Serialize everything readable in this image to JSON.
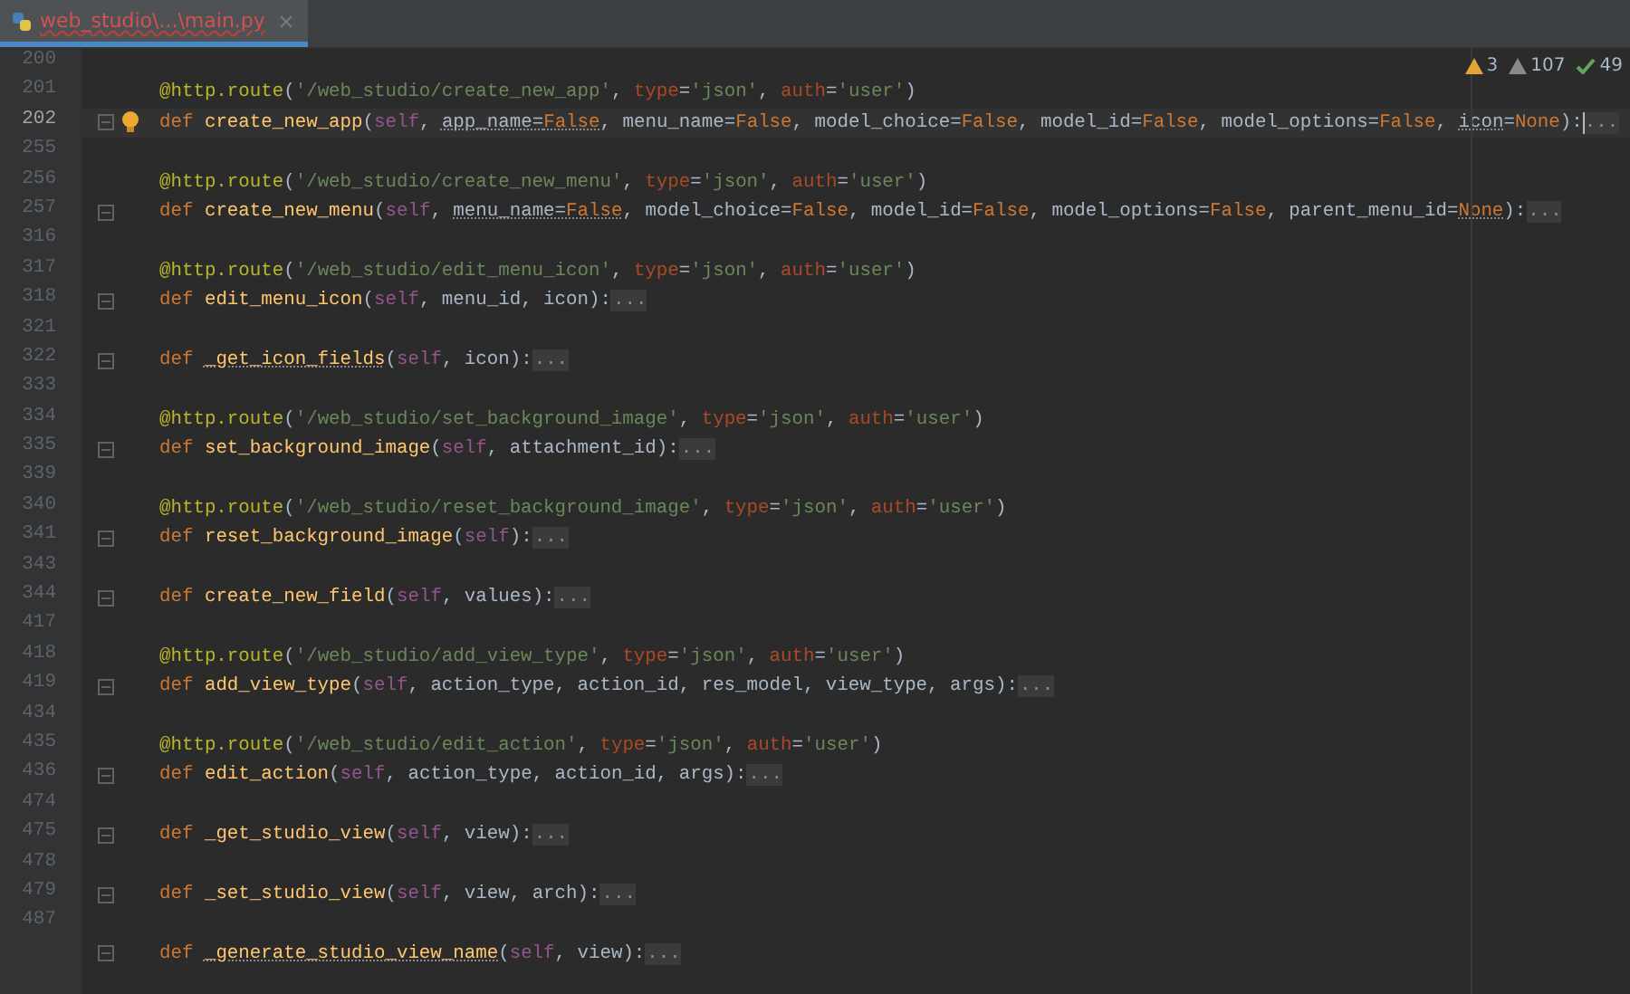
{
  "tab": {
    "title": "web_studio\\...\\main.py",
    "selected": true
  },
  "inspections": [
    {
      "kind": "warning",
      "count": "3"
    },
    {
      "kind": "weak",
      "count": "107"
    },
    {
      "kind": "typo",
      "count": "49"
    }
  ],
  "lines": [
    {
      "number": "200"
    },
    {
      "number": "201",
      "tokens": [
        {
          "kind": "deco",
          "text": "@http.route"
        },
        {
          "kind": "punct",
          "text": "("
        },
        {
          "kind": "str",
          "text": "'/web_studio/create_new_app'"
        },
        {
          "kind": "punct",
          "text": ", "
        },
        {
          "kind": "kwarg",
          "text": "type"
        },
        {
          "kind": "punct",
          "text": "="
        },
        {
          "kind": "str",
          "text": "'json'"
        },
        {
          "kind": "punct",
          "text": ", "
        },
        {
          "kind": "kwarg",
          "text": "auth"
        },
        {
          "kind": "punct",
          "text": "="
        },
        {
          "kind": "str",
          "text": "'user'"
        },
        {
          "kind": "punct",
          "text": ")"
        }
      ]
    },
    {
      "number": "202",
      "current": true,
      "intention": true,
      "foldable": true,
      "tokens": [
        {
          "kind": "kw",
          "text": "def "
        },
        {
          "kind": "fn",
          "text": "create_new_app"
        },
        {
          "kind": "punct",
          "text": "("
        },
        {
          "kind": "self",
          "text": "self"
        },
        {
          "kind": "punct",
          "text": ", "
        },
        {
          "kind": "param",
          "text": "app_name",
          "warn": true
        },
        {
          "kind": "punct",
          "text": "=",
          "warn": true
        },
        {
          "kind": "const",
          "text": "False",
          "warn": true
        },
        {
          "kind": "punct",
          "text": ", menu_name="
        },
        {
          "kind": "const",
          "text": "False"
        },
        {
          "kind": "punct",
          "text": ", model_choice="
        },
        {
          "kind": "const",
          "text": "False"
        },
        {
          "kind": "punct",
          "text": ", model_id="
        },
        {
          "kind": "const",
          "text": "False"
        },
        {
          "kind": "punct",
          "text": ", model_options="
        },
        {
          "kind": "const",
          "text": "False"
        },
        {
          "kind": "punct",
          "text": ", "
        },
        {
          "kind": "param",
          "text": "icon",
          "warn": true
        },
        {
          "kind": "punct",
          "text": "="
        },
        {
          "kind": "const",
          "text": "None"
        },
        {
          "kind": "punct",
          "text": "):"
        },
        {
          "kind": "fold",
          "text": "..."
        }
      ]
    },
    {
      "number": "255"
    },
    {
      "number": "256",
      "tokens": [
        {
          "kind": "deco",
          "text": "@http.route"
        },
        {
          "kind": "punct",
          "text": "("
        },
        {
          "kind": "str",
          "text": "'/web_studio/create_new_menu'"
        },
        {
          "kind": "punct",
          "text": ", "
        },
        {
          "kind": "kwarg",
          "text": "type"
        },
        {
          "kind": "punct",
          "text": "="
        },
        {
          "kind": "str",
          "text": "'json'"
        },
        {
          "kind": "punct",
          "text": ", "
        },
        {
          "kind": "kwarg",
          "text": "auth"
        },
        {
          "kind": "punct",
          "text": "="
        },
        {
          "kind": "str",
          "text": "'user'"
        },
        {
          "kind": "punct",
          "text": ")"
        }
      ]
    },
    {
      "number": "257",
      "foldable": true,
      "tokens": [
        {
          "kind": "kw",
          "text": "def "
        },
        {
          "kind": "fn",
          "text": "create_new_menu"
        },
        {
          "kind": "punct",
          "text": "("
        },
        {
          "kind": "self",
          "text": "self"
        },
        {
          "kind": "punct",
          "text": ", "
        },
        {
          "kind": "param",
          "text": "menu_name",
          "warn": true
        },
        {
          "kind": "punct",
          "text": "=",
          "warn": true
        },
        {
          "kind": "const",
          "text": "False",
          "warn": true
        },
        {
          "kind": "punct",
          "text": ", model_choice="
        },
        {
          "kind": "const",
          "text": "False"
        },
        {
          "kind": "punct",
          "text": ", model_id="
        },
        {
          "kind": "const",
          "text": "False"
        },
        {
          "kind": "punct",
          "text": ", model_options="
        },
        {
          "kind": "const",
          "text": "False"
        },
        {
          "kind": "punct",
          "text": ", parent_menu_id="
        },
        {
          "kind": "const",
          "text": "None",
          "warn": true
        },
        {
          "kind": "punct",
          "text": "):"
        },
        {
          "kind": "fold",
          "text": "..."
        }
      ]
    },
    {
      "number": "316"
    },
    {
      "number": "317",
      "tokens": [
        {
          "kind": "deco",
          "text": "@http.route"
        },
        {
          "kind": "punct",
          "text": "("
        },
        {
          "kind": "str",
          "text": "'/web_studio/edit_menu_icon'"
        },
        {
          "kind": "punct",
          "text": ", "
        },
        {
          "kind": "kwarg",
          "text": "type"
        },
        {
          "kind": "punct",
          "text": "="
        },
        {
          "kind": "str",
          "text": "'json'"
        },
        {
          "kind": "punct",
          "text": ", "
        },
        {
          "kind": "kwarg",
          "text": "auth"
        },
        {
          "kind": "punct",
          "text": "="
        },
        {
          "kind": "str",
          "text": "'user'"
        },
        {
          "kind": "punct",
          "text": ")"
        }
      ]
    },
    {
      "number": "318",
      "foldable": true,
      "tokens": [
        {
          "kind": "kw",
          "text": "def "
        },
        {
          "kind": "fn",
          "text": "edit_menu_icon"
        },
        {
          "kind": "punct",
          "text": "("
        },
        {
          "kind": "self",
          "text": "self"
        },
        {
          "kind": "punct",
          "text": ", menu_id, icon):"
        },
        {
          "kind": "fold",
          "text": "..."
        }
      ]
    },
    {
      "number": "321"
    },
    {
      "number": "322",
      "foldable": true,
      "tokens": [
        {
          "kind": "kw",
          "text": "def "
        },
        {
          "kind": "fn",
          "text": "_get_icon_fields",
          "warn": true
        },
        {
          "kind": "punct",
          "text": "("
        },
        {
          "kind": "self",
          "text": "self"
        },
        {
          "kind": "punct",
          "text": ", icon):"
        },
        {
          "kind": "fold",
          "text": "..."
        }
      ]
    },
    {
      "number": "333"
    },
    {
      "number": "334",
      "tokens": [
        {
          "kind": "deco",
          "text": "@http.route"
        },
        {
          "kind": "punct",
          "text": "("
        },
        {
          "kind": "str",
          "text": "'/web_studio/set_background_image'"
        },
        {
          "kind": "punct",
          "text": ", "
        },
        {
          "kind": "kwarg",
          "text": "type"
        },
        {
          "kind": "punct",
          "text": "="
        },
        {
          "kind": "str",
          "text": "'json'"
        },
        {
          "kind": "punct",
          "text": ", "
        },
        {
          "kind": "kwarg",
          "text": "auth"
        },
        {
          "kind": "punct",
          "text": "="
        },
        {
          "kind": "str",
          "text": "'user'"
        },
        {
          "kind": "punct",
          "text": ")"
        }
      ]
    },
    {
      "number": "335",
      "foldable": true,
      "tokens": [
        {
          "kind": "kw",
          "text": "def "
        },
        {
          "kind": "fn",
          "text": "set_background_image"
        },
        {
          "kind": "punct",
          "text": "("
        },
        {
          "kind": "self",
          "text": "self"
        },
        {
          "kind": "punct",
          "text": ", attachment_id):"
        },
        {
          "kind": "fold",
          "text": "..."
        }
      ]
    },
    {
      "number": "339"
    },
    {
      "number": "340",
      "tokens": [
        {
          "kind": "deco",
          "text": "@http.route"
        },
        {
          "kind": "punct",
          "text": "("
        },
        {
          "kind": "str",
          "text": "'/web_studio/reset_background_image'"
        },
        {
          "kind": "punct",
          "text": ", "
        },
        {
          "kind": "kwarg",
          "text": "type"
        },
        {
          "kind": "punct",
          "text": "="
        },
        {
          "kind": "str",
          "text": "'json'"
        },
        {
          "kind": "punct",
          "text": ", "
        },
        {
          "kind": "kwarg",
          "text": "auth"
        },
        {
          "kind": "punct",
          "text": "="
        },
        {
          "kind": "str",
          "text": "'user'"
        },
        {
          "kind": "punct",
          "text": ")"
        }
      ]
    },
    {
      "number": "341",
      "foldable": true,
      "tokens": [
        {
          "kind": "kw",
          "text": "def "
        },
        {
          "kind": "fn",
          "text": "reset_background_image"
        },
        {
          "kind": "punct",
          "text": "("
        },
        {
          "kind": "self",
          "text": "self"
        },
        {
          "kind": "punct",
          "text": "):"
        },
        {
          "kind": "fold",
          "text": "..."
        }
      ]
    },
    {
      "number": "343"
    },
    {
      "number": "344",
      "foldable": true,
      "tokens": [
        {
          "kind": "kw",
          "text": "def "
        },
        {
          "kind": "fn",
          "text": "create_new_field"
        },
        {
          "kind": "punct",
          "text": "("
        },
        {
          "kind": "self",
          "text": "self"
        },
        {
          "kind": "punct",
          "text": ", values):"
        },
        {
          "kind": "fold",
          "text": "..."
        }
      ]
    },
    {
      "number": "417"
    },
    {
      "number": "418",
      "tokens": [
        {
          "kind": "deco",
          "text": "@http.route"
        },
        {
          "kind": "punct",
          "text": "("
        },
        {
          "kind": "str",
          "text": "'/web_studio/add_view_type'"
        },
        {
          "kind": "punct",
          "text": ", "
        },
        {
          "kind": "kwarg",
          "text": "type"
        },
        {
          "kind": "punct",
          "text": "="
        },
        {
          "kind": "str",
          "text": "'json'"
        },
        {
          "kind": "punct",
          "text": ", "
        },
        {
          "kind": "kwarg",
          "text": "auth"
        },
        {
          "kind": "punct",
          "text": "="
        },
        {
          "kind": "str",
          "text": "'user'"
        },
        {
          "kind": "punct",
          "text": ")"
        }
      ]
    },
    {
      "number": "419",
      "foldable": true,
      "tokens": [
        {
          "kind": "kw",
          "text": "def "
        },
        {
          "kind": "fn",
          "text": "add_view_type"
        },
        {
          "kind": "punct",
          "text": "("
        },
        {
          "kind": "self",
          "text": "self"
        },
        {
          "kind": "punct",
          "text": ", action_type, action_id, res_model, view_type, args):"
        },
        {
          "kind": "fold",
          "text": "..."
        }
      ]
    },
    {
      "number": "434"
    },
    {
      "number": "435",
      "tokens": [
        {
          "kind": "deco",
          "text": "@http.route"
        },
        {
          "kind": "punct",
          "text": "("
        },
        {
          "kind": "str",
          "text": "'/web_studio/edit_action'"
        },
        {
          "kind": "punct",
          "text": ", "
        },
        {
          "kind": "kwarg",
          "text": "type"
        },
        {
          "kind": "punct",
          "text": "="
        },
        {
          "kind": "str",
          "text": "'json'"
        },
        {
          "kind": "punct",
          "text": ", "
        },
        {
          "kind": "kwarg",
          "text": "auth"
        },
        {
          "kind": "punct",
          "text": "="
        },
        {
          "kind": "str",
          "text": "'user'"
        },
        {
          "kind": "punct",
          "text": ")"
        }
      ]
    },
    {
      "number": "436",
      "foldable": true,
      "tokens": [
        {
          "kind": "kw",
          "text": "def "
        },
        {
          "kind": "fn",
          "text": "edit_action"
        },
        {
          "kind": "punct",
          "text": "("
        },
        {
          "kind": "self",
          "text": "self"
        },
        {
          "kind": "punct",
          "text": ", action_type, action_id, args):"
        },
        {
          "kind": "fold",
          "text": "..."
        }
      ]
    },
    {
      "number": "474"
    },
    {
      "number": "475",
      "foldable": true,
      "tokens": [
        {
          "kind": "kw",
          "text": "def "
        },
        {
          "kind": "fn",
          "text": "_get_studio_view"
        },
        {
          "kind": "punct",
          "text": "("
        },
        {
          "kind": "self",
          "text": "self"
        },
        {
          "kind": "punct",
          "text": ", view):"
        },
        {
          "kind": "fold",
          "text": "..."
        }
      ]
    },
    {
      "number": "478"
    },
    {
      "number": "479",
      "foldable": true,
      "tokens": [
        {
          "kind": "kw",
          "text": "def "
        },
        {
          "kind": "fn",
          "text": "_set_studio_view"
        },
        {
          "kind": "punct",
          "text": "("
        },
        {
          "kind": "self",
          "text": "self"
        },
        {
          "kind": "punct",
          "text": ", view, arch):"
        },
        {
          "kind": "fold",
          "text": "..."
        }
      ]
    },
    {
      "number": "487"
    },
    {
      "foldable": true,
      "tokens": [
        {
          "kind": "kw",
          "text": "def "
        },
        {
          "kind": "fn",
          "text": "_generate_studio_view_name",
          "warn": true
        },
        {
          "kind": "punct",
          "text": "("
        },
        {
          "kind": "self",
          "text": "self"
        },
        {
          "kind": "punct",
          "text": ", view):"
        },
        {
          "kind": "fold",
          "text": "..."
        }
      ]
    }
  ]
}
